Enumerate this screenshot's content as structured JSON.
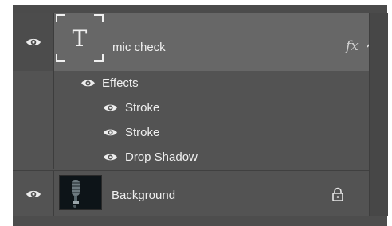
{
  "layers": [
    {
      "name": "mic check",
      "type": "text",
      "thumbnail_glyph": "T",
      "visible_icon": "eye-icon",
      "fx_label": "fx",
      "expand_icon": "chevron-up-icon",
      "effects_header": "Effects",
      "effects": [
        {
          "label": "Stroke"
        },
        {
          "label": "Stroke"
        },
        {
          "label": "Drop Shadow"
        }
      ]
    },
    {
      "name": "Background",
      "type": "image",
      "visible_icon": "eye-icon",
      "lock_icon": "lock-icon"
    }
  ],
  "colors": {
    "panel": "#535353",
    "selected": "#676767",
    "text": "#efefef"
  }
}
